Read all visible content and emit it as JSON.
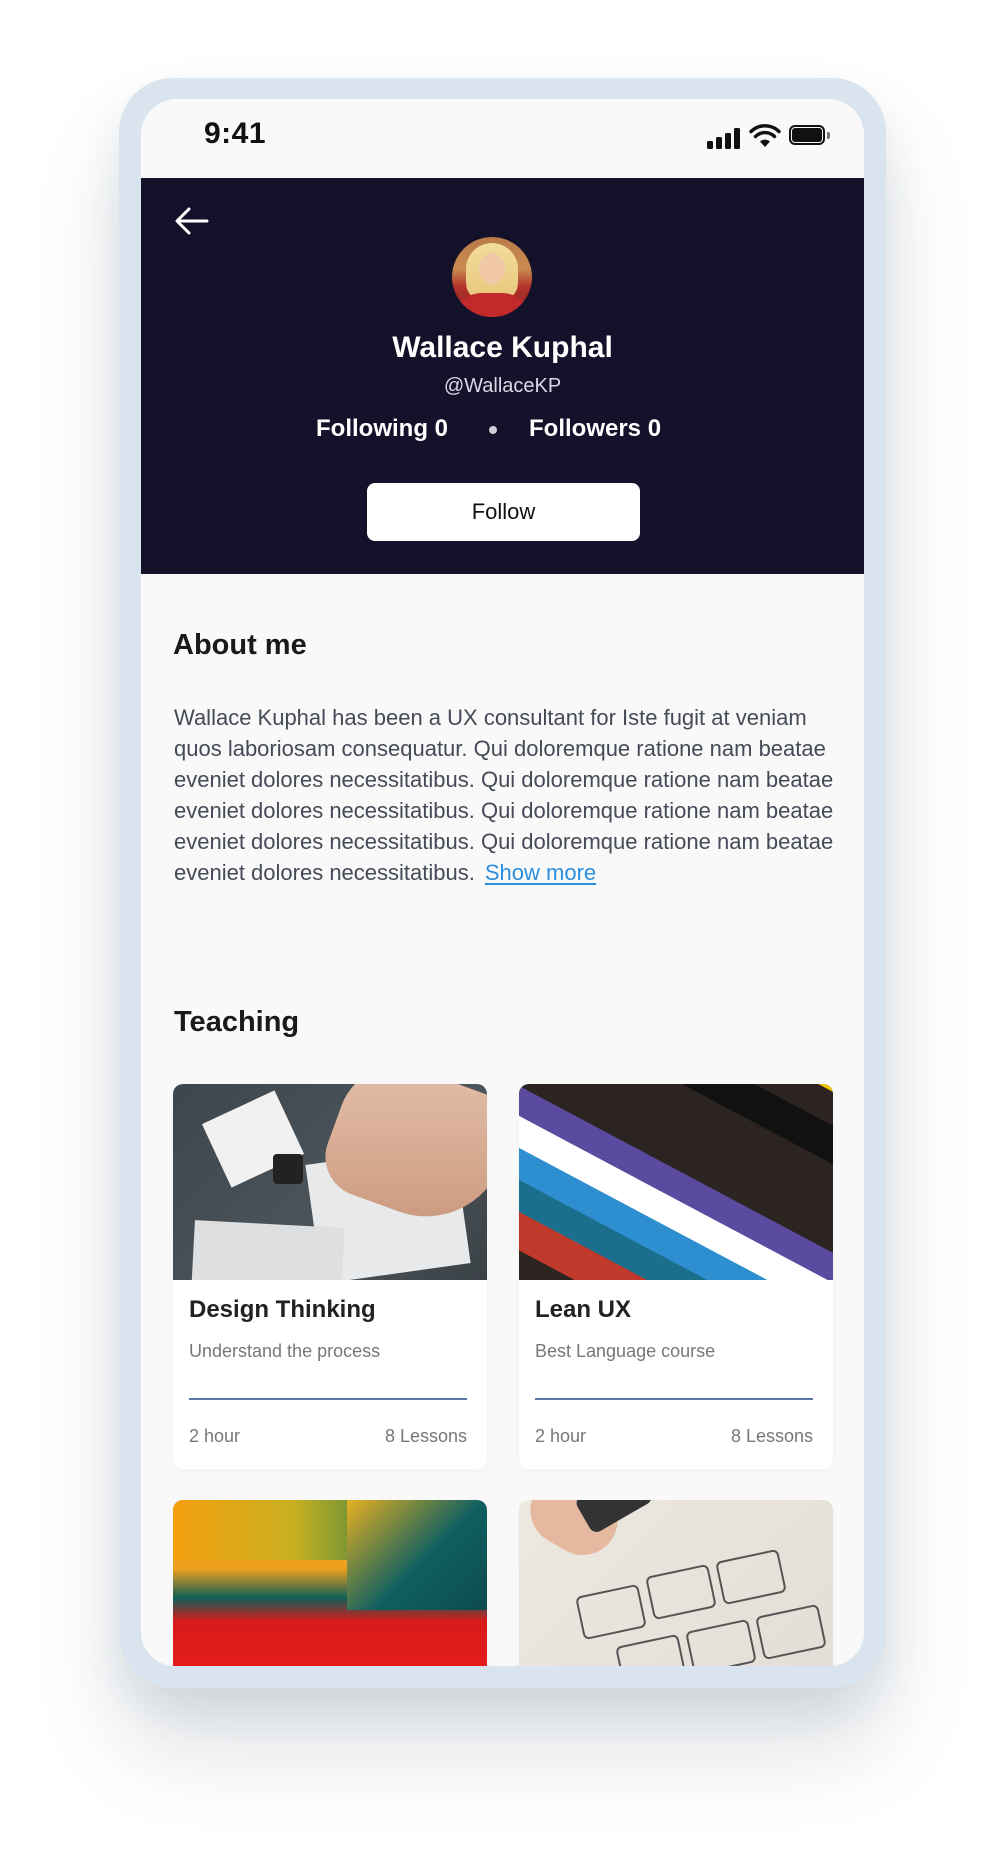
{
  "status_bar": {
    "time": "9:41"
  },
  "profile": {
    "name": "Wallace Kuphal",
    "handle": "@WallaceKP",
    "following_label": "Following 0",
    "followers_label": "Followers 0",
    "follow_button": "Follow"
  },
  "about": {
    "title": "About me",
    "text": "Wallace Kuphal has been a UX consultant for Iste fugit at veniam quos laboriosam consequatur. Qui doloremque ratione nam beatae eveniet dolores necessitatibus. Qui doloremque ratione nam beatae eveniet dolores necessitatibus. Qui doloremque ratione nam beatae eveniet dolores necessitatibus. Qui doloremque ratione nam beatae eveniet dolores necessitatibus.",
    "show_more": "Show more"
  },
  "teaching": {
    "title": "Teaching",
    "courses": [
      {
        "title": "Design Thinking",
        "subtitle": "Understand the process",
        "duration": "2 hour",
        "lessons": "8 Lessons"
      },
      {
        "title": "Lean UX",
        "subtitle": "Best Language course",
        "duration": "2 hour",
        "lessons": "8 Lessons"
      }
    ]
  },
  "icons": {
    "back": "arrow-left-icon",
    "signal": "cellular-signal-icon",
    "wifi": "wifi-icon",
    "battery": "battery-icon"
  },
  "colors": {
    "header_bg": "#14112a",
    "link": "#2b8fe0",
    "divider": "#5578a8",
    "device_frame": "#dae4ef"
  }
}
